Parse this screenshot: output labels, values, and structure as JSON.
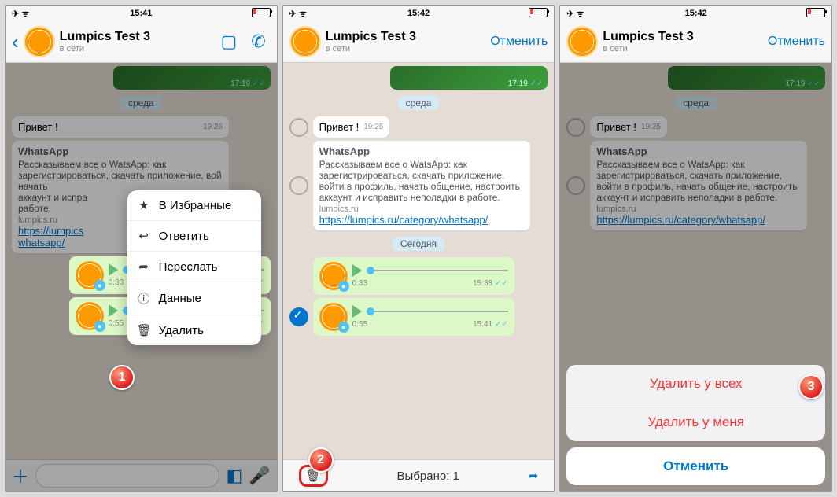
{
  "status": {
    "time1": "15:41",
    "time2": "15:42",
    "time3": "15:42"
  },
  "contact": {
    "name": "Lumpics Test 3",
    "status": "в сети"
  },
  "header": {
    "cancel": "Отменить"
  },
  "day": {
    "sreda": "среда",
    "today": "Сегодня"
  },
  "msg": {
    "img_time": "17:19",
    "greet": "Привет !",
    "greet_time": "19:25",
    "wa_head": "WhatsApp",
    "wa_body": "Рассказываем все о WatsApp: как зарегистрироваться, скачать приложение, войти в профиль, начать общение, настроить аккаунт и исправить неполадки в работе.",
    "wa_body_short": "Рассказываем все о WatsApp: как зарегистрироваться, скачать приложение, вой",
    "wa_body_mid": "начать\nаккаунт и испра\nработе.",
    "wa_src": "lumpics.ru",
    "link_full": "https://lumpics.ru/category/whatsapp/",
    "link_short": "https://lumpics\nwhatsapp/",
    "v1_dur": "0:33",
    "v1_time": "15:38",
    "v2_dur": "0:55",
    "v2_time": "15:41"
  },
  "menu": {
    "fav": "В Избранные",
    "reply": "Ответить",
    "fwd": "Переслать",
    "info": "Данные",
    "del": "Удалить"
  },
  "selbar": {
    "selected": "Выбрано: 1"
  },
  "sheet": {
    "del_all": "Удалить у всех",
    "del_me": "Удалить у меня",
    "cancel": "Отменить"
  },
  "badges": {
    "b1": "1",
    "b2": "2",
    "b3": "3"
  }
}
